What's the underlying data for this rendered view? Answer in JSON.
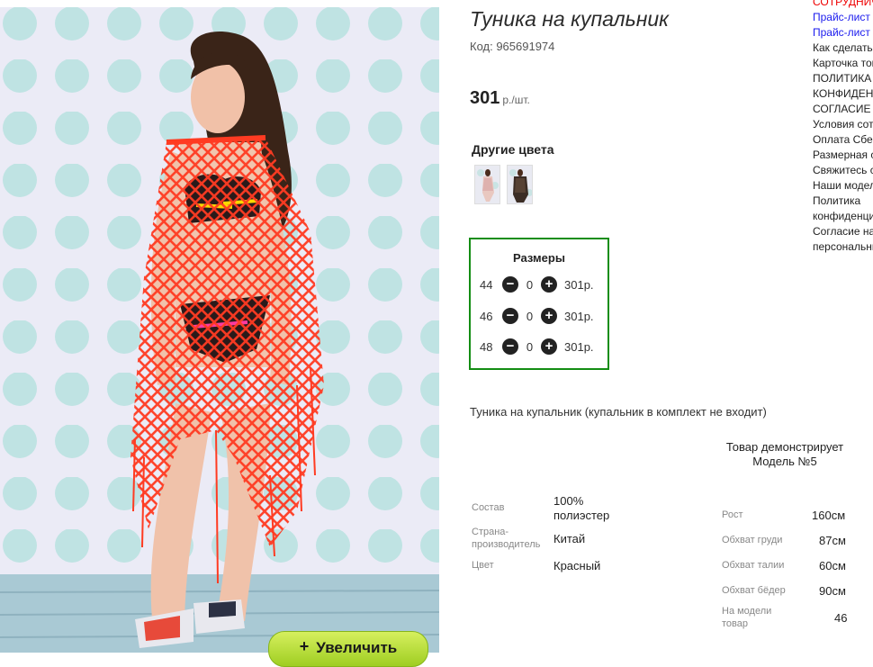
{
  "product": {
    "title": "Туника на купальник",
    "code": "Код: 965691974",
    "price": "301",
    "price_unit": "р./шт.",
    "zoom_label": "Увеличить",
    "zoom_icon": "+",
    "other_colors_title": "Другие цвета",
    "description": "Туника на купальник (купальник в комплект не входит)"
  },
  "sizes": {
    "title": "Размеры",
    "rows": [
      {
        "size": "44",
        "qty": "0",
        "price": "301р."
      },
      {
        "size": "46",
        "qty": "0",
        "price": "301р."
      },
      {
        "size": "48",
        "qty": "0",
        "price": "301р."
      }
    ],
    "minus_icon": "−",
    "plus_icon": "+"
  },
  "specs": [
    {
      "label": "Состав",
      "value": "100% полиэстер"
    },
    {
      "label": "Страна-производитель",
      "value": "Китай"
    },
    {
      "label": "Цвет",
      "value": "Красный"
    }
  ],
  "model": {
    "caption": "Товар демонстрирует Модель №5",
    "params": [
      {
        "label": "Рост",
        "value": "160см"
      },
      {
        "label": "Обхват груди",
        "value": "87см"
      },
      {
        "label": "Обхват талии",
        "value": "60см"
      },
      {
        "label": "Обхват бёдер",
        "value": "90см"
      },
      {
        "label": "На модели товар",
        "value": "46"
      }
    ]
  },
  "side_menu": [
    {
      "text": "СОТРУДНИЧЕСТВО",
      "style": "red"
    },
    {
      "text": "Прайс-лист",
      "style": "link"
    },
    {
      "text": "Прайс-лист",
      "style": "link"
    },
    {
      "text": "Как сделать заказ",
      "style": "plain"
    },
    {
      "text": "Карточка товара",
      "style": "plain"
    },
    {
      "text": "ПОЛИТИКА",
      "style": "plain"
    },
    {
      "text": "КОНФИДЕНЦИАЛЬНОСТИ",
      "style": "plain"
    },
    {
      "text": "СОГЛАСИЕ",
      "style": "plain"
    },
    {
      "text": "Условия сотрудничества",
      "style": "plain"
    },
    {
      "text": "Оплата Сбербанк",
      "style": "plain"
    },
    {
      "text": "Размерная сетка",
      "style": "plain"
    },
    {
      "text": "Свяжитесь с нами",
      "style": "plain"
    },
    {
      "text": "Наши модели",
      "style": "plain"
    },
    {
      "text": "Политика",
      "style": "plain"
    },
    {
      "text": "конфиденциальности",
      "style": "plain"
    },
    {
      "text": "Согласие на обработку",
      "style": "plain"
    },
    {
      "text": "персональных данных",
      "style": "plain"
    }
  ],
  "colors": {
    "accent_green": "#138d13",
    "button_green": "#9fce22",
    "tunic_red": "#e8321f",
    "link_blue": "#1a1aee",
    "menu_red": "#ee0000"
  }
}
